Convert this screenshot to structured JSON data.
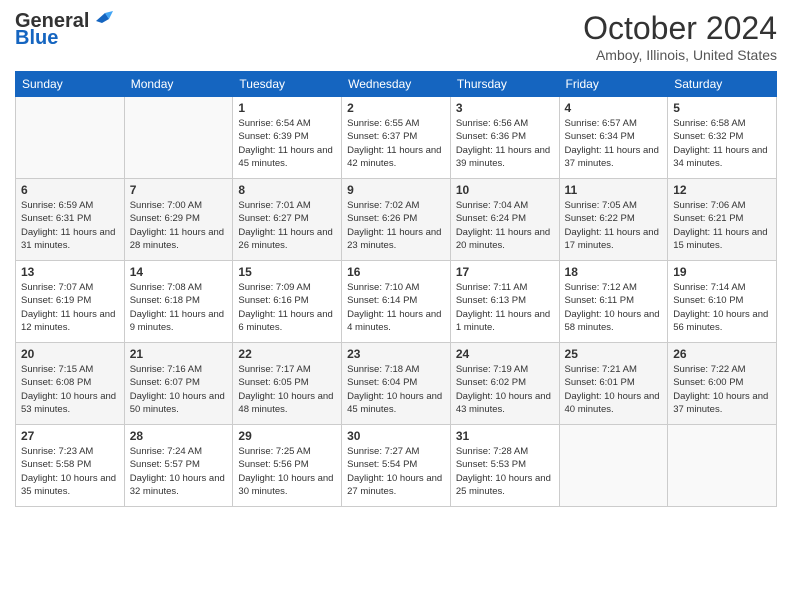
{
  "logo": {
    "line1": "General",
    "line2": "Blue"
  },
  "title": "October 2024",
  "location": "Amboy, Illinois, United States",
  "days_header": [
    "Sunday",
    "Monday",
    "Tuesday",
    "Wednesday",
    "Thursday",
    "Friday",
    "Saturday"
  ],
  "weeks": [
    [
      {
        "num": "",
        "info": ""
      },
      {
        "num": "",
        "info": ""
      },
      {
        "num": "1",
        "info": "Sunrise: 6:54 AM\nSunset: 6:39 PM\nDaylight: 11 hours and 45 minutes."
      },
      {
        "num": "2",
        "info": "Sunrise: 6:55 AM\nSunset: 6:37 PM\nDaylight: 11 hours and 42 minutes."
      },
      {
        "num": "3",
        "info": "Sunrise: 6:56 AM\nSunset: 6:36 PM\nDaylight: 11 hours and 39 minutes."
      },
      {
        "num": "4",
        "info": "Sunrise: 6:57 AM\nSunset: 6:34 PM\nDaylight: 11 hours and 37 minutes."
      },
      {
        "num": "5",
        "info": "Sunrise: 6:58 AM\nSunset: 6:32 PM\nDaylight: 11 hours and 34 minutes."
      }
    ],
    [
      {
        "num": "6",
        "info": "Sunrise: 6:59 AM\nSunset: 6:31 PM\nDaylight: 11 hours and 31 minutes."
      },
      {
        "num": "7",
        "info": "Sunrise: 7:00 AM\nSunset: 6:29 PM\nDaylight: 11 hours and 28 minutes."
      },
      {
        "num": "8",
        "info": "Sunrise: 7:01 AM\nSunset: 6:27 PM\nDaylight: 11 hours and 26 minutes."
      },
      {
        "num": "9",
        "info": "Sunrise: 7:02 AM\nSunset: 6:26 PM\nDaylight: 11 hours and 23 minutes."
      },
      {
        "num": "10",
        "info": "Sunrise: 7:04 AM\nSunset: 6:24 PM\nDaylight: 11 hours and 20 minutes."
      },
      {
        "num": "11",
        "info": "Sunrise: 7:05 AM\nSunset: 6:22 PM\nDaylight: 11 hours and 17 minutes."
      },
      {
        "num": "12",
        "info": "Sunrise: 7:06 AM\nSunset: 6:21 PM\nDaylight: 11 hours and 15 minutes."
      }
    ],
    [
      {
        "num": "13",
        "info": "Sunrise: 7:07 AM\nSunset: 6:19 PM\nDaylight: 11 hours and 12 minutes."
      },
      {
        "num": "14",
        "info": "Sunrise: 7:08 AM\nSunset: 6:18 PM\nDaylight: 11 hours and 9 minutes."
      },
      {
        "num": "15",
        "info": "Sunrise: 7:09 AM\nSunset: 6:16 PM\nDaylight: 11 hours and 6 minutes."
      },
      {
        "num": "16",
        "info": "Sunrise: 7:10 AM\nSunset: 6:14 PM\nDaylight: 11 hours and 4 minutes."
      },
      {
        "num": "17",
        "info": "Sunrise: 7:11 AM\nSunset: 6:13 PM\nDaylight: 11 hours and 1 minute."
      },
      {
        "num": "18",
        "info": "Sunrise: 7:12 AM\nSunset: 6:11 PM\nDaylight: 10 hours and 58 minutes."
      },
      {
        "num": "19",
        "info": "Sunrise: 7:14 AM\nSunset: 6:10 PM\nDaylight: 10 hours and 56 minutes."
      }
    ],
    [
      {
        "num": "20",
        "info": "Sunrise: 7:15 AM\nSunset: 6:08 PM\nDaylight: 10 hours and 53 minutes."
      },
      {
        "num": "21",
        "info": "Sunrise: 7:16 AM\nSunset: 6:07 PM\nDaylight: 10 hours and 50 minutes."
      },
      {
        "num": "22",
        "info": "Sunrise: 7:17 AM\nSunset: 6:05 PM\nDaylight: 10 hours and 48 minutes."
      },
      {
        "num": "23",
        "info": "Sunrise: 7:18 AM\nSunset: 6:04 PM\nDaylight: 10 hours and 45 minutes."
      },
      {
        "num": "24",
        "info": "Sunrise: 7:19 AM\nSunset: 6:02 PM\nDaylight: 10 hours and 43 minutes."
      },
      {
        "num": "25",
        "info": "Sunrise: 7:21 AM\nSunset: 6:01 PM\nDaylight: 10 hours and 40 minutes."
      },
      {
        "num": "26",
        "info": "Sunrise: 7:22 AM\nSunset: 6:00 PM\nDaylight: 10 hours and 37 minutes."
      }
    ],
    [
      {
        "num": "27",
        "info": "Sunrise: 7:23 AM\nSunset: 5:58 PM\nDaylight: 10 hours and 35 minutes."
      },
      {
        "num": "28",
        "info": "Sunrise: 7:24 AM\nSunset: 5:57 PM\nDaylight: 10 hours and 32 minutes."
      },
      {
        "num": "29",
        "info": "Sunrise: 7:25 AM\nSunset: 5:56 PM\nDaylight: 10 hours and 30 minutes."
      },
      {
        "num": "30",
        "info": "Sunrise: 7:27 AM\nSunset: 5:54 PM\nDaylight: 10 hours and 27 minutes."
      },
      {
        "num": "31",
        "info": "Sunrise: 7:28 AM\nSunset: 5:53 PM\nDaylight: 10 hours and 25 minutes."
      },
      {
        "num": "",
        "info": ""
      },
      {
        "num": "",
        "info": ""
      }
    ]
  ]
}
